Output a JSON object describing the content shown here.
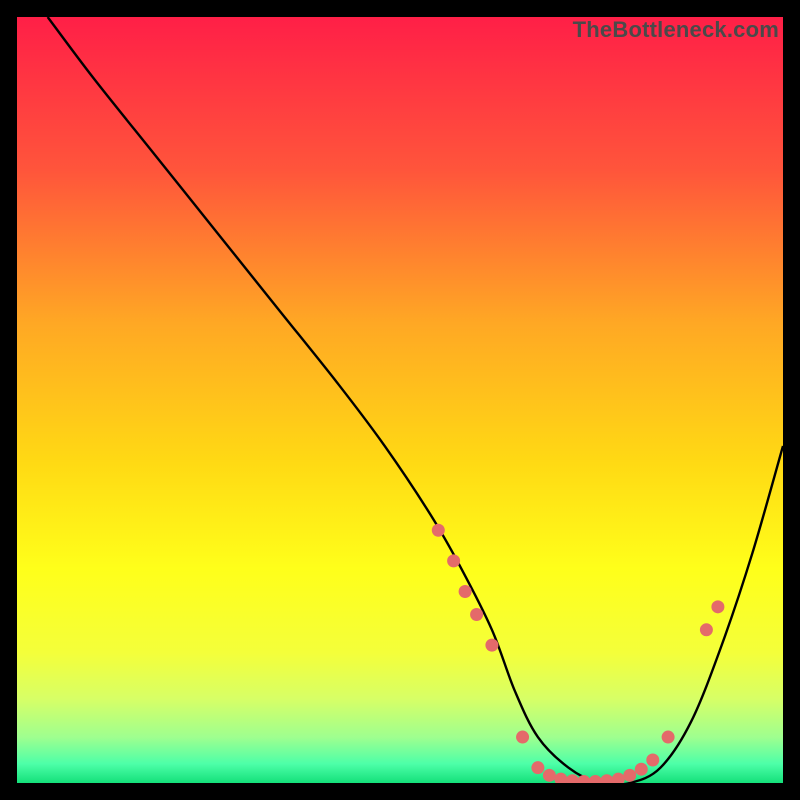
{
  "watermark": "TheBottleneck.com",
  "chart_data": {
    "type": "line",
    "title": "",
    "xlabel": "",
    "ylabel": "",
    "xlim": [
      0,
      100
    ],
    "ylim": [
      0,
      100
    ],
    "gradient_stops": [
      {
        "offset": 0.0,
        "color": "#ff1f47"
      },
      {
        "offset": 0.2,
        "color": "#ff553b"
      },
      {
        "offset": 0.4,
        "color": "#ffa824"
      },
      {
        "offset": 0.58,
        "color": "#ffd914"
      },
      {
        "offset": 0.72,
        "color": "#ffff1a"
      },
      {
        "offset": 0.83,
        "color": "#f4ff3a"
      },
      {
        "offset": 0.89,
        "color": "#d7ff66"
      },
      {
        "offset": 0.94,
        "color": "#9fff8f"
      },
      {
        "offset": 0.975,
        "color": "#4dffa8"
      },
      {
        "offset": 1.0,
        "color": "#14e07a"
      }
    ],
    "series": [
      {
        "name": "bottleneck-curve",
        "x": [
          4,
          10,
          18,
          26,
          34,
          42,
          48,
          54,
          58,
          62,
          65,
          68,
          72,
          76,
          80,
          84,
          88,
          92,
          96,
          100
        ],
        "y": [
          100,
          92,
          82,
          72,
          62,
          52,
          44,
          35,
          28,
          20,
          12,
          6,
          2,
          0,
          0,
          2,
          8,
          18,
          30,
          44
        ]
      }
    ],
    "scatter": {
      "name": "highlight-points",
      "color": "#e46a6a",
      "points": [
        {
          "x": 55.0,
          "y": 33
        },
        {
          "x": 57.0,
          "y": 29
        },
        {
          "x": 58.5,
          "y": 25
        },
        {
          "x": 60.0,
          "y": 22
        },
        {
          "x": 62.0,
          "y": 18
        },
        {
          "x": 66.0,
          "y": 6
        },
        {
          "x": 68.0,
          "y": 2
        },
        {
          "x": 69.5,
          "y": 1
        },
        {
          "x": 71.0,
          "y": 0.5
        },
        {
          "x": 72.5,
          "y": 0.3
        },
        {
          "x": 74.0,
          "y": 0.2
        },
        {
          "x": 75.5,
          "y": 0.2
        },
        {
          "x": 77.0,
          "y": 0.3
        },
        {
          "x": 78.5,
          "y": 0.5
        },
        {
          "x": 80.0,
          "y": 1
        },
        {
          "x": 81.5,
          "y": 1.8
        },
        {
          "x": 83.0,
          "y": 3
        },
        {
          "x": 85.0,
          "y": 6
        },
        {
          "x": 90.0,
          "y": 20
        },
        {
          "x": 91.5,
          "y": 23
        }
      ]
    }
  }
}
